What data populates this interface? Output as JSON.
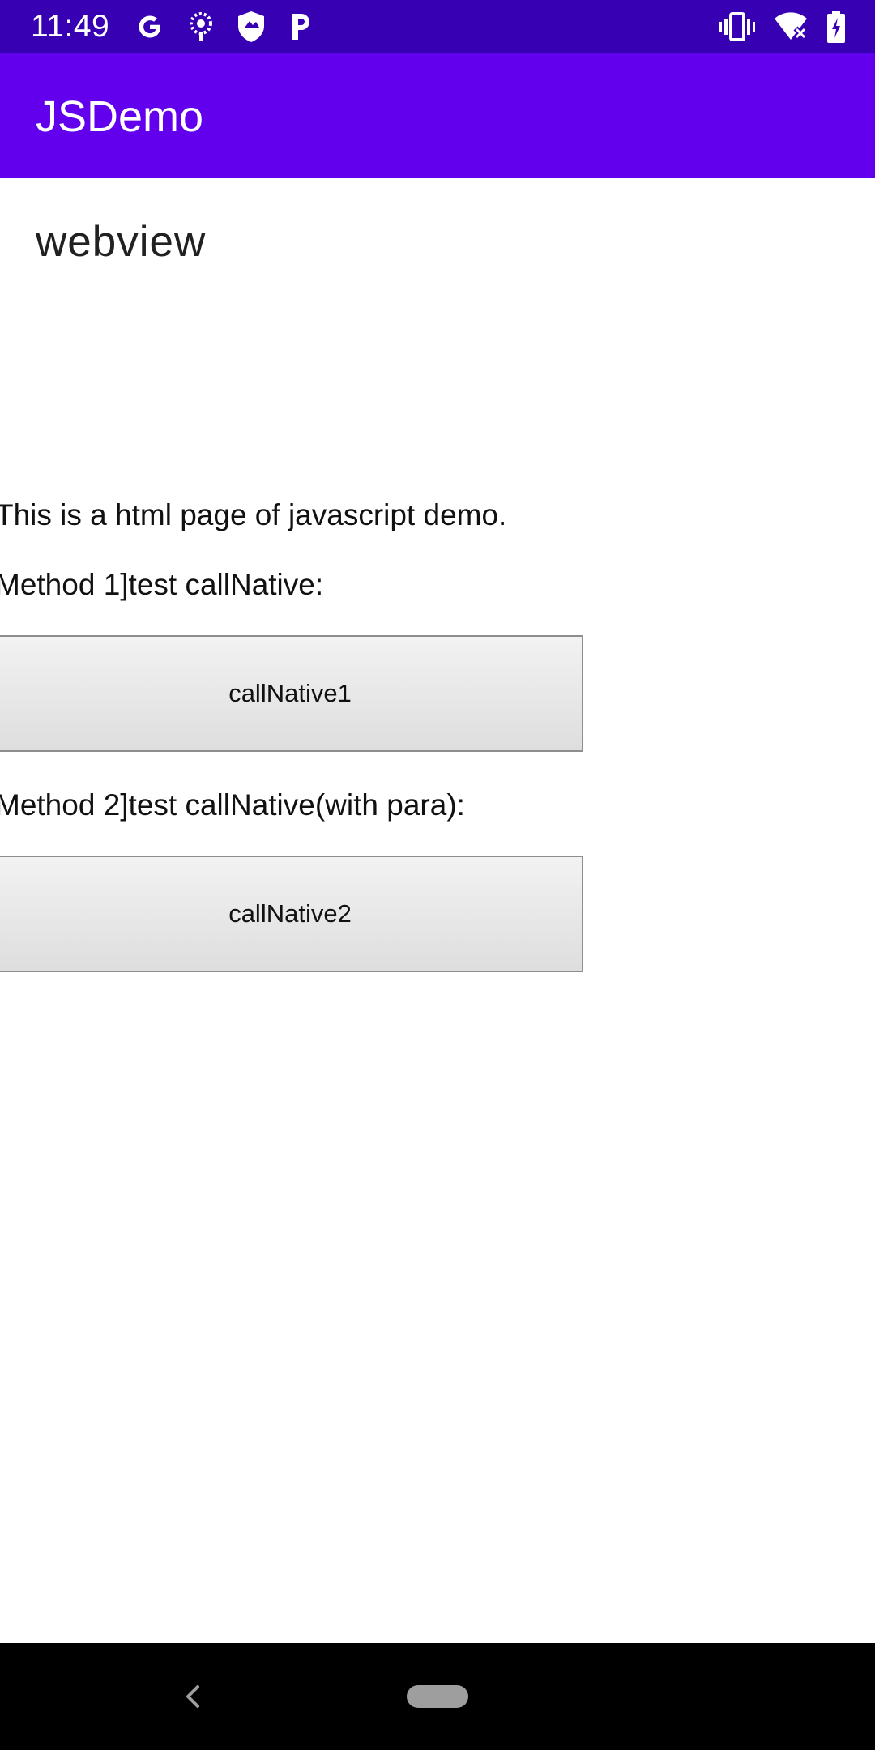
{
  "status_bar": {
    "time": "11:49",
    "left_icons": [
      "google-g-icon",
      "pinwheel-icon",
      "shield-icon",
      "p-app-icon"
    ],
    "right_icons": [
      "vibrate-icon",
      "wifi-off-icon",
      "battery-charging-icon"
    ],
    "background": "#3700b3"
  },
  "app_bar": {
    "title": "JSDemo",
    "background": "#6200ee"
  },
  "content": {
    "heading": "webview",
    "web_page": {
      "intro": "This is a html page of javascript demo.",
      "method1_label": "Method 1]test callNative:",
      "button1_label": "callNative1",
      "method2_label": "Method 2]test callNative(with para):",
      "button2_label": "callNative2"
    }
  },
  "nav_bar": {
    "icons": [
      "back-icon",
      "home-pill-icon"
    ]
  }
}
